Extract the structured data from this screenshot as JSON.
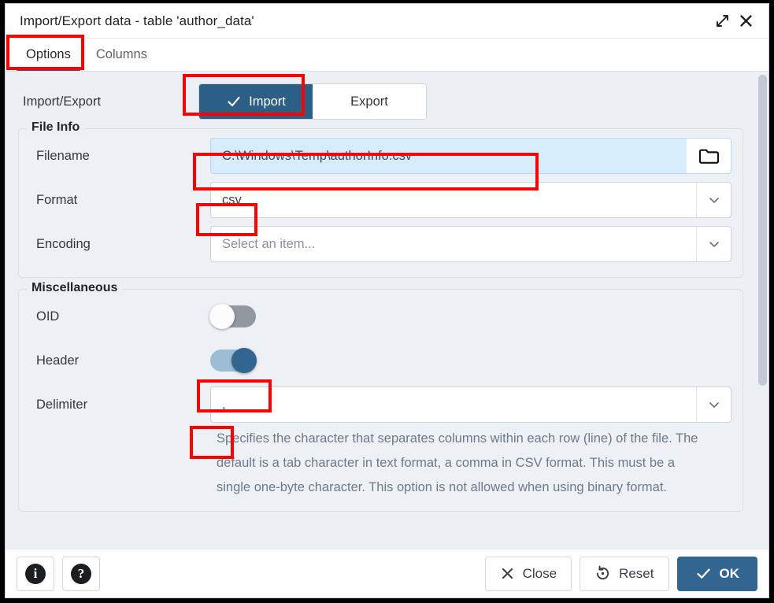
{
  "window": {
    "title": "Import/Export data - table 'author_data'",
    "maximize_icon": "expand-diagonal-icon",
    "close_icon": "close-icon"
  },
  "tabs": [
    {
      "label": "Options",
      "active": true
    },
    {
      "label": "Columns",
      "active": false
    }
  ],
  "form": {
    "import_export": {
      "label": "Import/Export",
      "options": [
        {
          "label": "Import",
          "selected": true,
          "icon": "check-icon"
        },
        {
          "label": "Export",
          "selected": false
        }
      ]
    },
    "file_info": {
      "legend": "File Info",
      "filename": {
        "label": "Filename",
        "value": "C:\\Windows\\Temp\\authorInfo.csv",
        "browse_icon": "folder-icon",
        "focused": true
      },
      "format": {
        "label": "Format",
        "value": "csv",
        "caret_icon": "chevron-down-icon"
      },
      "encoding": {
        "label": "Encoding",
        "value": "",
        "placeholder": "Select an item...",
        "caret_icon": "chevron-down-icon"
      }
    },
    "miscellaneous": {
      "legend": "Miscellaneous",
      "oid": {
        "label": "OID",
        "state": "off"
      },
      "header": {
        "label": "Header",
        "state": "on"
      },
      "delimiter": {
        "label": "Delimiter",
        "value": ",",
        "caret_icon": "chevron-down-icon",
        "help": "Specifies the character that separates columns within each row (line) of the file. The default is a tab character in text format, a comma in CSV format. This must be a single one-byte character. This option is not allowed when using binary format."
      }
    }
  },
  "footer": {
    "info_label": "i",
    "help_label": "?",
    "close_label": "Close",
    "reset_label": "Reset",
    "ok_label": "OK"
  },
  "colors": {
    "accent": "#326690",
    "tab_underline": "#2c5f86",
    "focus_field": "#d6ecfa",
    "annotation": "#ff0000",
    "switch_off": "#9198a0",
    "switch_on_track": "#9dbdd6"
  }
}
